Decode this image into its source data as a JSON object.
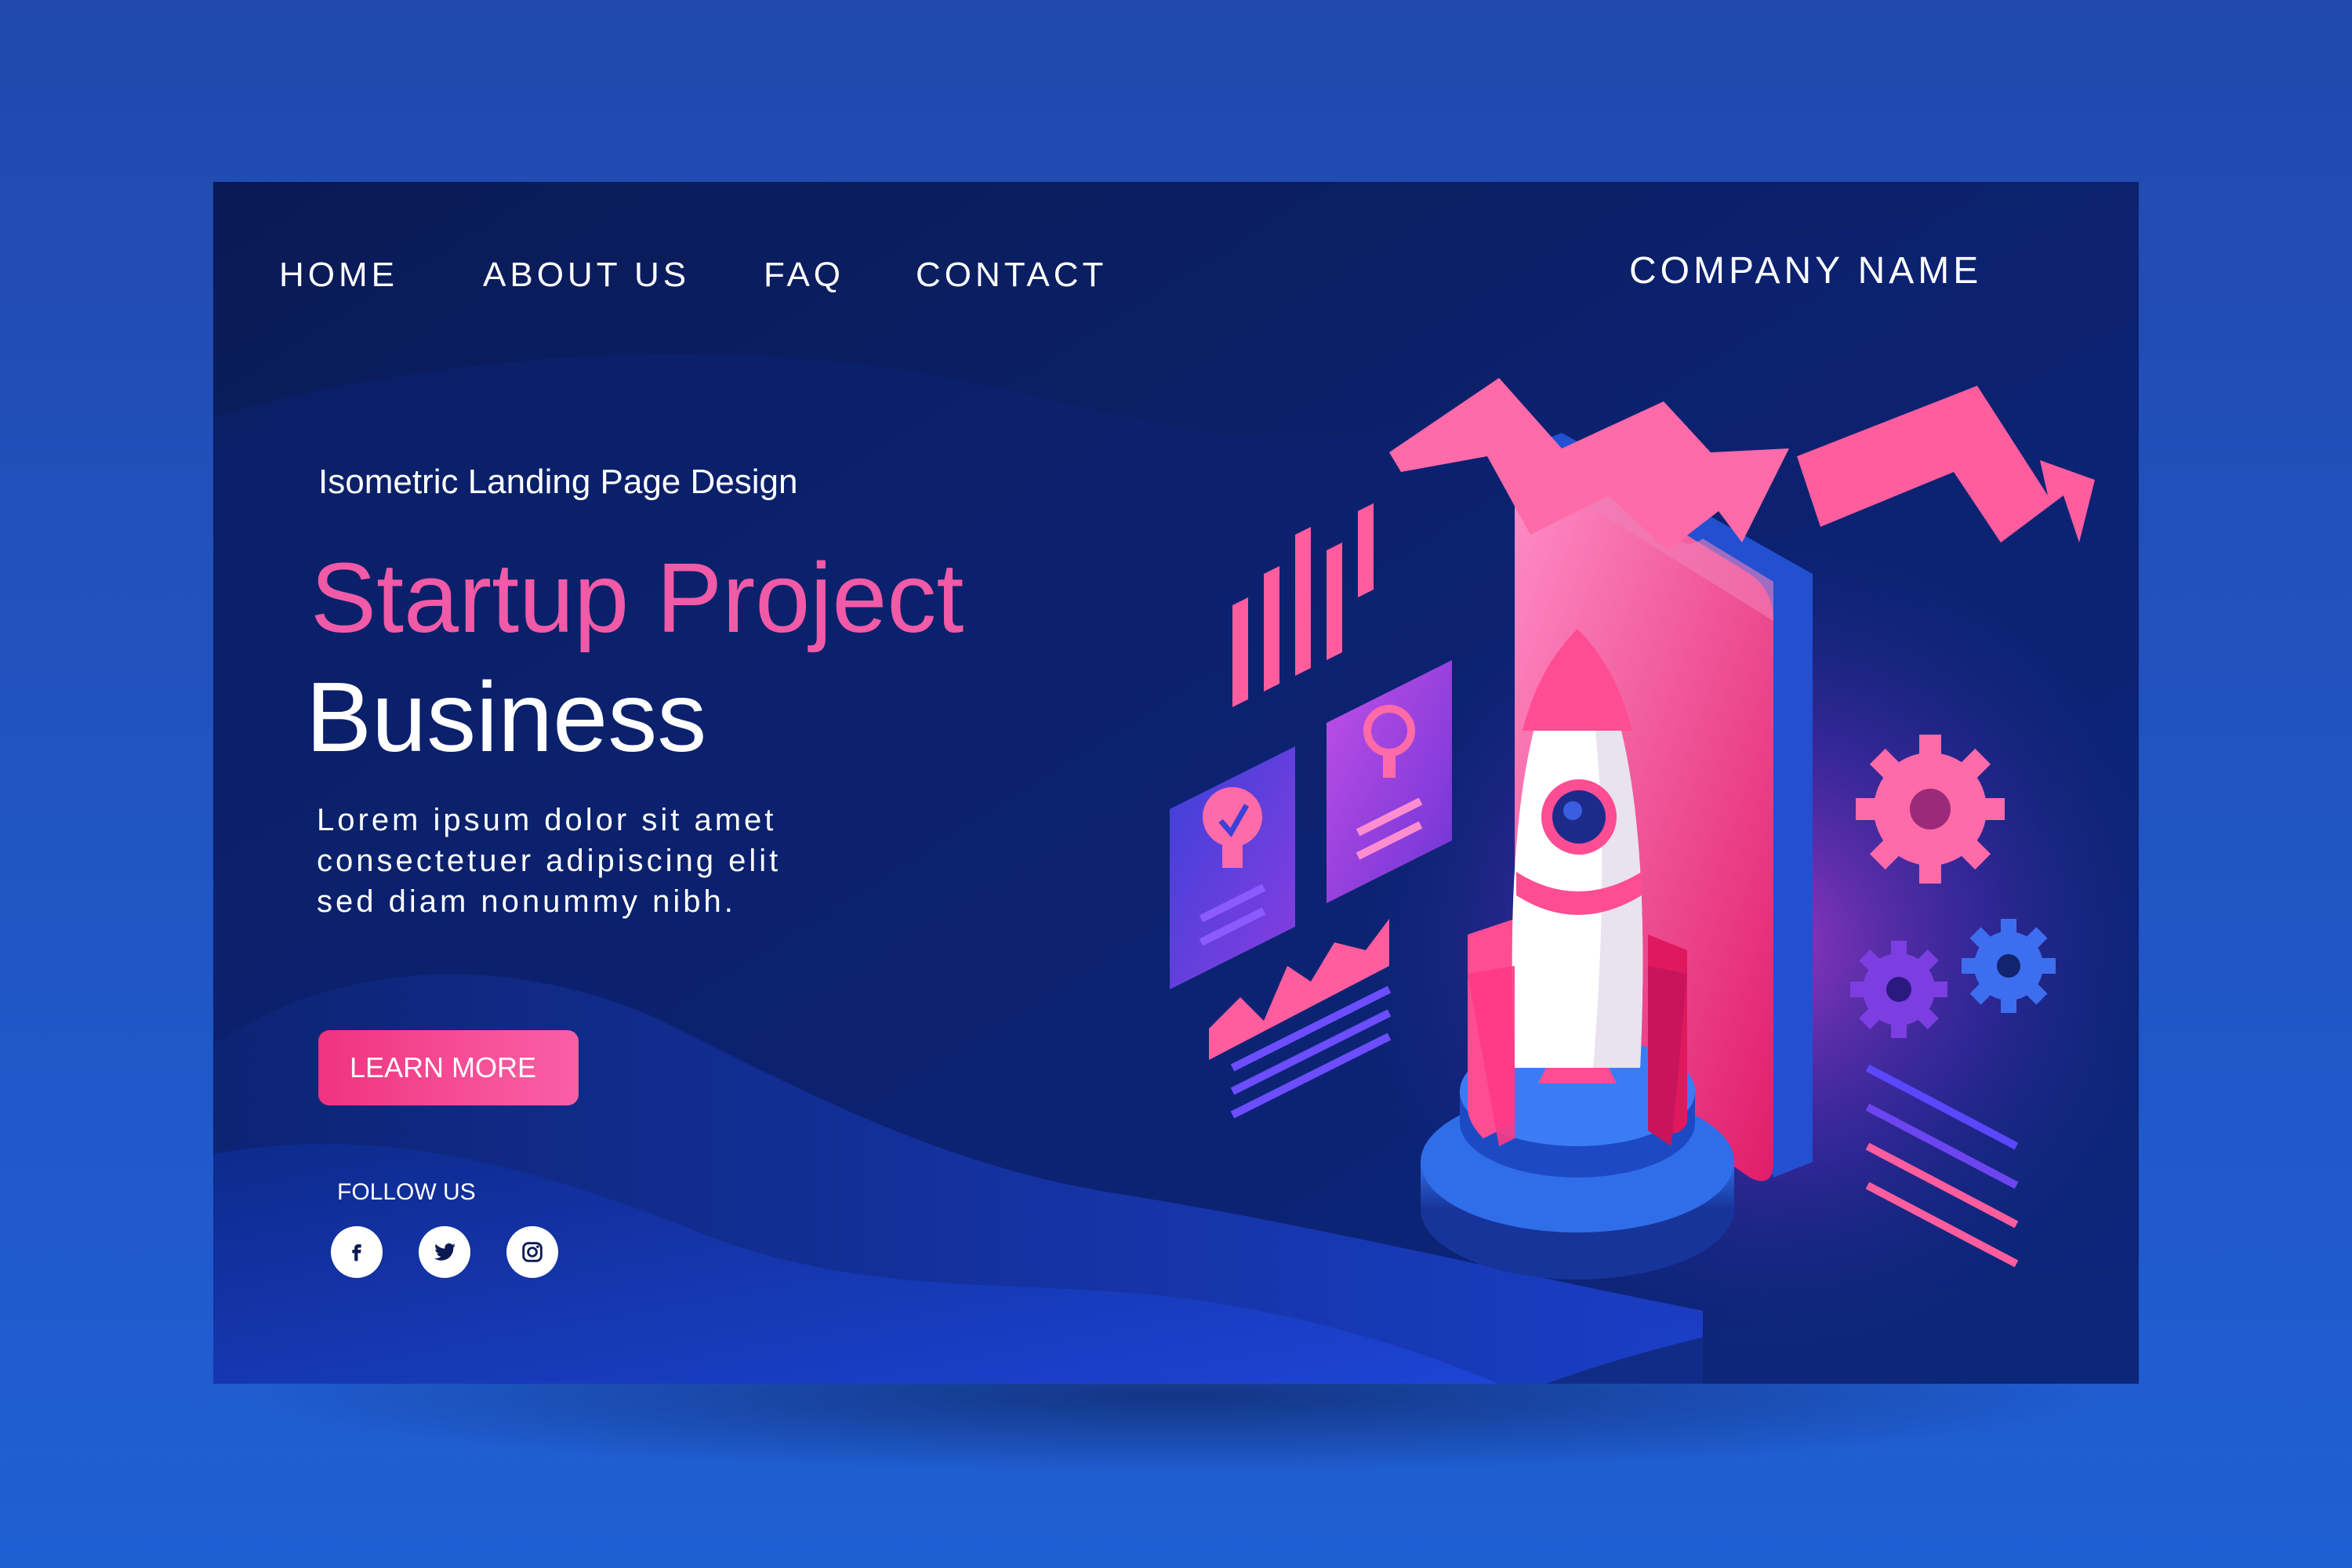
{
  "nav": {
    "items": [
      {
        "label": "HOME"
      },
      {
        "label": "ABOUT US"
      },
      {
        "label": "FAQ"
      },
      {
        "label": "CONTACT"
      }
    ],
    "brand": "COMPANY NAME"
  },
  "hero": {
    "subtitle": "Isometric Landing Page Design",
    "headline_line1": "Startup Project",
    "headline_line2": "Business",
    "body_lines": [
      "Lorem ipsum dolor sit amet",
      "consectetuer adipiscing elit",
      "sed diam nonummy nibh."
    ],
    "cta_label": "LEARN MORE"
  },
  "social": {
    "label": "FOLLOW US",
    "icons": [
      "facebook-icon",
      "twitter-icon",
      "instagram-icon"
    ]
  },
  "colors": {
    "background": "#2155c4",
    "card": "#0b1a52",
    "accent_pink": "#f05aa7",
    "button": "#f0337e"
  }
}
